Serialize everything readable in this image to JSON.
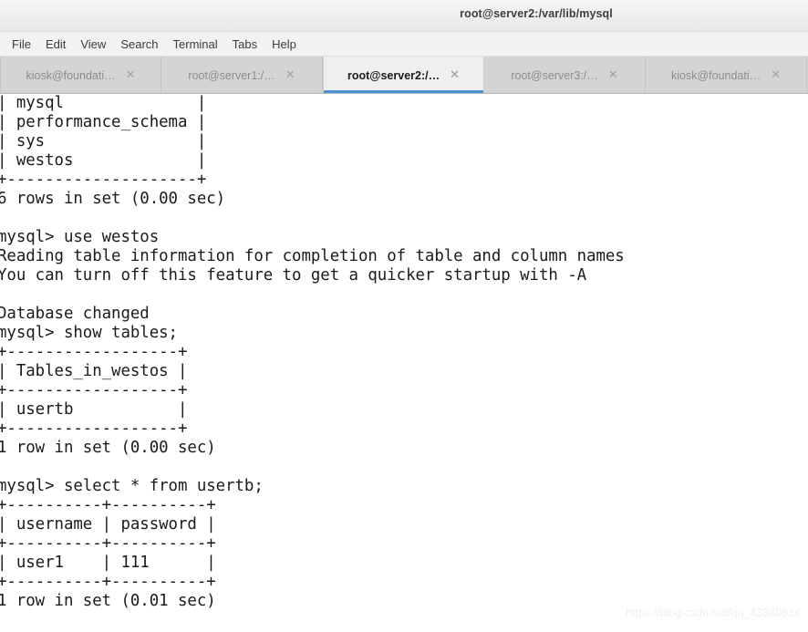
{
  "window": {
    "title": "root@server2:/var/lib/mysql"
  },
  "menubar": {
    "items": [
      {
        "label": "File",
        "name": "menu-file"
      },
      {
        "label": "Edit",
        "name": "menu-edit"
      },
      {
        "label": "View",
        "name": "menu-view"
      },
      {
        "label": "Search",
        "name": "menu-search"
      },
      {
        "label": "Terminal",
        "name": "menu-terminal"
      },
      {
        "label": "Tabs",
        "name": "menu-tabs"
      },
      {
        "label": "Help",
        "name": "menu-help"
      }
    ]
  },
  "tabs": {
    "close_glyph": "✕",
    "active_index": 2,
    "items": [
      {
        "label": "kiosk@foundati…",
        "active": false
      },
      {
        "label": "root@server1:/…",
        "active": false
      },
      {
        "label": "root@server2:/…",
        "active": true
      },
      {
        "label": "root@server3:/…",
        "active": false
      },
      {
        "label": "kiosk@foundati…",
        "active": false
      }
    ]
  },
  "terminal": {
    "lines": [
      "| mysql              |",
      "| performance_schema |",
      "| sys                |",
      "| westos             |",
      "+--------------------+",
      "6 rows in set (0.00 sec)",
      "",
      "mysql> use westos",
      "Reading table information for completion of table and column names",
      "You can turn off this feature to get a quicker startup with -A",
      "",
      "Database changed",
      "mysql> show tables;",
      "+------------------+",
      "| Tables_in_westos |",
      "+------------------+",
      "| usertb           |",
      "+------------------+",
      "1 row in set (0.00 sec)",
      "",
      "mysql> select * from usertb;",
      "+----------+----------+",
      "| username | password |",
      "+----------+----------+",
      "| user1    | 111      |",
      "+----------+----------+",
      "1 row in set (0.01 sec)",
      ""
    ]
  },
  "watermark": {
    "text": "https://blog.csdn.net/qq_43340814"
  },
  "colors": {
    "accent": "#4a90d9",
    "titlebar": "#eeeeee",
    "tabbar": "#d4d4d4",
    "active_tab": "#efefef",
    "terminal_bg": "#ffffff",
    "terminal_fg": "#1b1b1b"
  }
}
